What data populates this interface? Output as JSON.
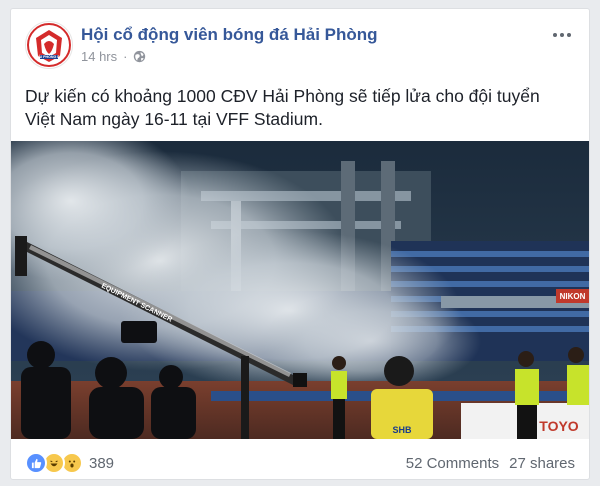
{
  "post": {
    "page_name": "Hội cổ động viên bóng đá Hải Phòng",
    "time": "14 hrs",
    "privacy_icon": "globe-icon",
    "avatar_text": "HẢI PHÒNG FC",
    "text": "Dự kiến có khoảng 1000 CĐV Hải Phòng sẽ tiếp lửa cho đội tuyển Việt Nam ngày 16-11 tại VFF Stadium."
  },
  "photo": {
    "crane_text": "EQUIPMENT SCANNER",
    "ad_banner": "SHB",
    "right_banner": "TOYO",
    "stand_banner": "NIKON"
  },
  "footer": {
    "reaction_icons": [
      "like-icon",
      "haha-icon",
      "wow-icon"
    ],
    "reaction_count": "389",
    "comments": "52 Comments",
    "shares": "27 shares"
  },
  "colors": {
    "link": "#365899",
    "text": "#1d2129",
    "meta": "#90949c",
    "like": "#5890ff"
  }
}
